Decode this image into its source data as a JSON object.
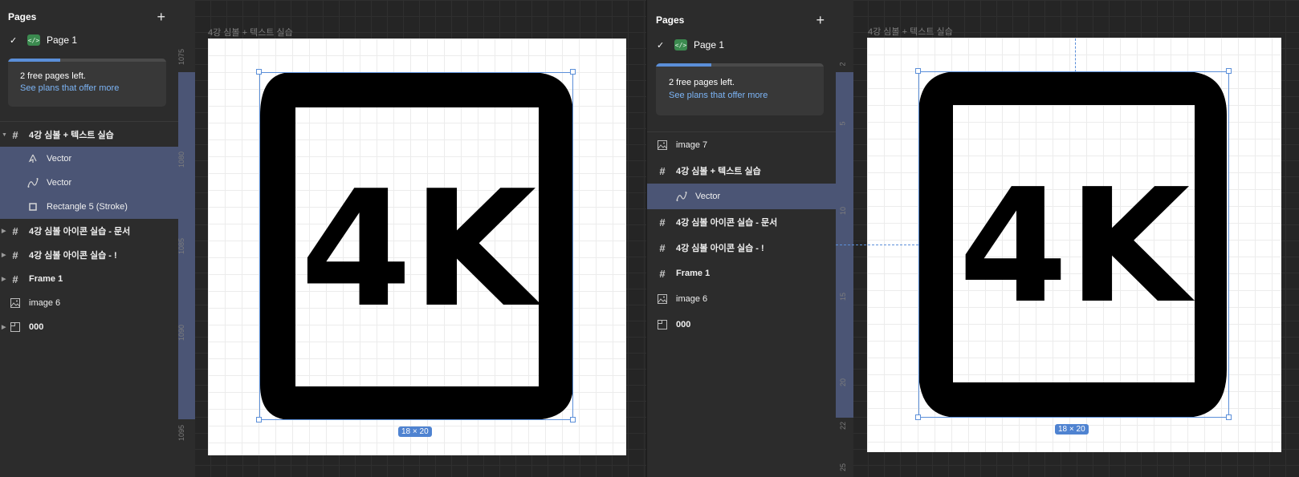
{
  "left_panel": {
    "title": "Pages",
    "add_icon": "plus-icon",
    "page_name": "Page 1",
    "plan_line1": "2 free pages left.",
    "plan_link": "See plans that offer more",
    "plan_progress": 0.33,
    "layers": [
      {
        "label": "4강 심볼 + 텍스트 실습",
        "icon": "frame-hash-icon"
      },
      {
        "label": "Vector",
        "icon": "vector-pen-icon"
      },
      {
        "label": "Vector",
        "icon": "vector-path-icon"
      },
      {
        "label": "Rectangle 5 (Stroke)",
        "icon": "rectangle-icon"
      },
      {
        "label": "4강 심볼 아이콘 실습 - 문서",
        "icon": "frame-hash-icon"
      },
      {
        "label": "4강 심볼 아이콘 실습 - !",
        "icon": "frame-hash-icon"
      },
      {
        "label": "Frame 1",
        "icon": "frame-hash-icon"
      },
      {
        "label": "image 6",
        "icon": "image-icon"
      },
      {
        "label": "000",
        "icon": "section-icon"
      }
    ]
  },
  "left_canvas": {
    "frame_label": "4강 심볼 + 텍스트 실습",
    "icon_text": "4K",
    "size_badge": "18 × 20",
    "ruler_ticks": [
      "1075",
      "1080",
      "1085",
      "1090",
      "1095"
    ]
  },
  "right_panel": {
    "title": "Pages",
    "add_icon": "plus-icon",
    "page_name": "Page 1",
    "plan_line1": "2 free pages left.",
    "plan_link": "See plans that offer more",
    "plan_progress": 0.33,
    "layers": [
      {
        "label": "image 7",
        "icon": "image-icon"
      },
      {
        "label": "4강 심볼 + 텍스트 실습",
        "icon": "frame-hash-icon"
      },
      {
        "label": "Vector",
        "icon": "vector-path-icon"
      },
      {
        "label": "4강 심볼 아이콘 실습 - 문서",
        "icon": "frame-hash-icon"
      },
      {
        "label": "4강 심볼 아이콘 실습 - !",
        "icon": "frame-hash-icon"
      },
      {
        "label": "Frame 1",
        "icon": "frame-hash-icon"
      },
      {
        "label": "image 6",
        "icon": "image-icon"
      },
      {
        "label": "000",
        "icon": "section-icon"
      }
    ]
  },
  "right_canvas": {
    "frame_label": "4강 심볼 + 텍스트 실습",
    "icon_text": "4K",
    "size_badge": "18 × 20",
    "ruler_ticks": [
      "2",
      "5",
      "10",
      "15",
      "20",
      "22",
      "25"
    ]
  },
  "colors": {
    "accent": "#5b8fd9",
    "selection": "#4b5575",
    "panel": "#2c2c2c",
    "canvas": "#252525"
  }
}
